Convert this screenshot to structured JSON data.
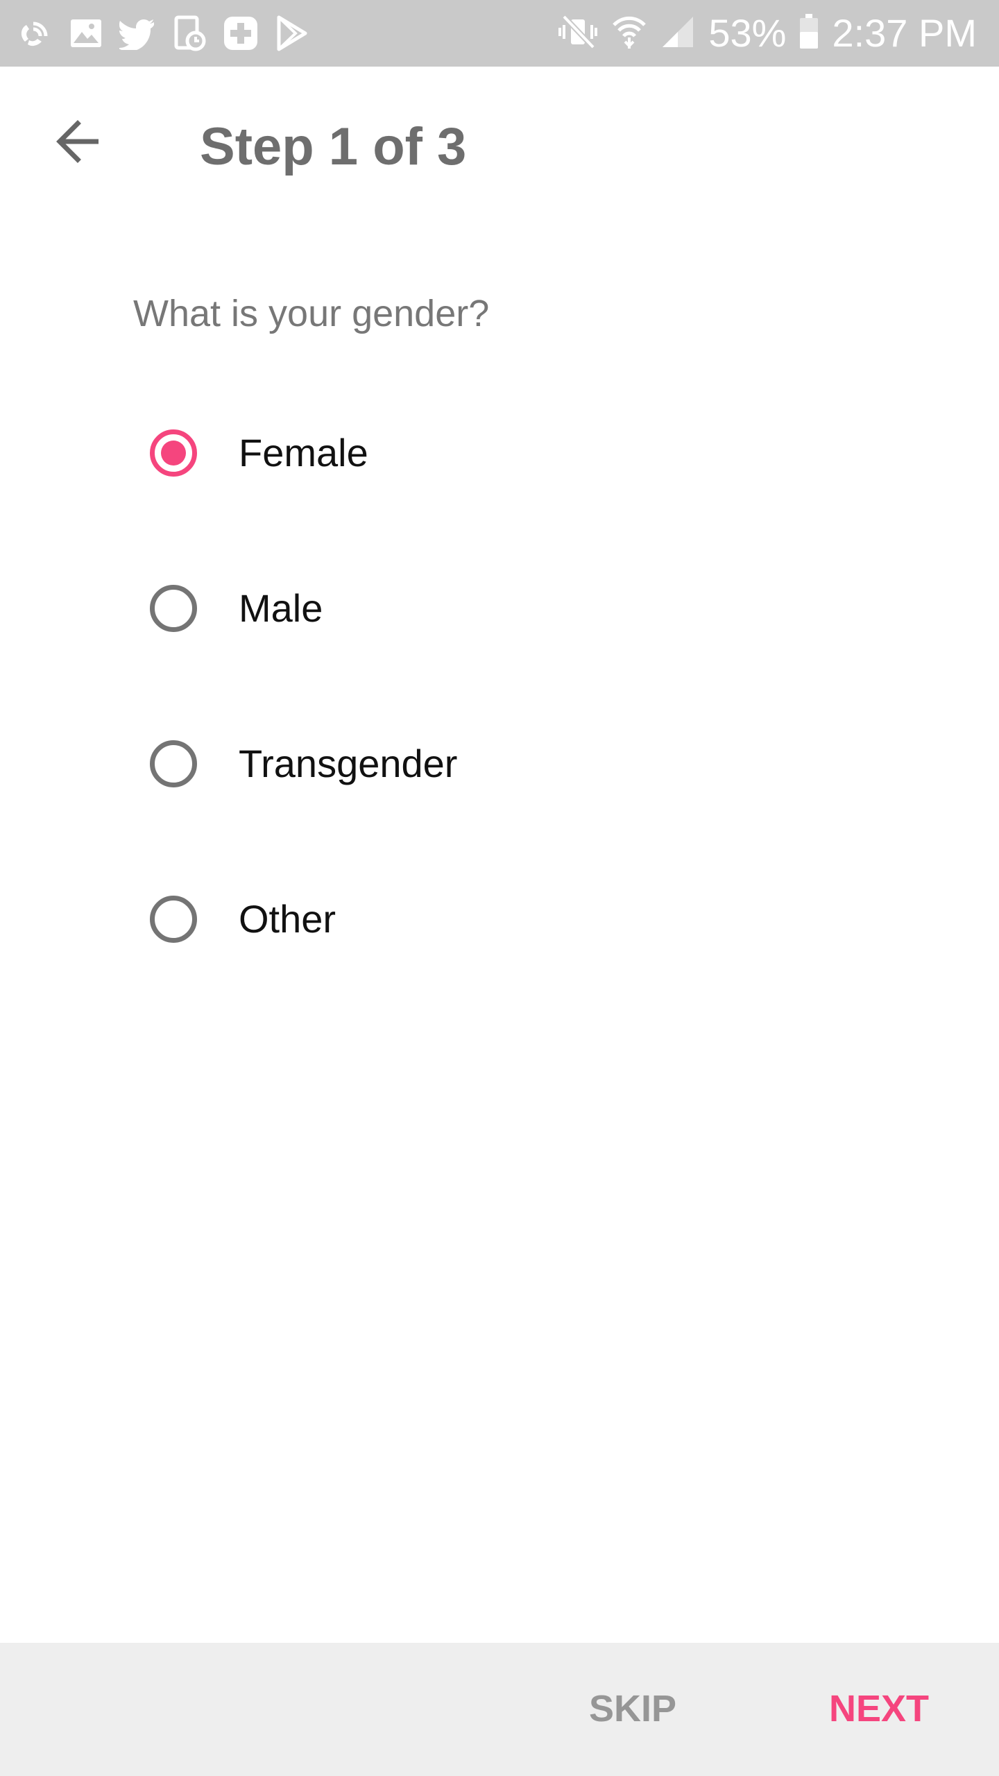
{
  "status_bar": {
    "left_icons": [
      "wifi-calling-icon",
      "gallery-icon",
      "twitter-icon",
      "calendar-icon",
      "medical-cross-icon",
      "play-store-icon"
    ],
    "right_icons": [
      "vibrate-mute-icon",
      "wifi-icon",
      "cell-signal-icon",
      "battery-icon"
    ],
    "battery_percent": "53%",
    "time": "2:37 PM"
  },
  "header": {
    "back_icon": "arrow-back-icon",
    "title": "Step 1 of 3"
  },
  "form": {
    "question": "What is your gender?",
    "options": [
      {
        "label": "Female",
        "selected": true
      },
      {
        "label": "Male",
        "selected": false
      },
      {
        "label": "Transgender",
        "selected": false
      },
      {
        "label": "Other",
        "selected": false
      }
    ]
  },
  "footer": {
    "skip_label": "SKIP",
    "next_label": "NEXT"
  },
  "colors": {
    "accent": "#f5457e",
    "status_bar_bg": "#c9c9c9",
    "footer_bg": "#eeeeee",
    "title_text": "#6e6e6e",
    "radio_unchecked": "#747474"
  }
}
